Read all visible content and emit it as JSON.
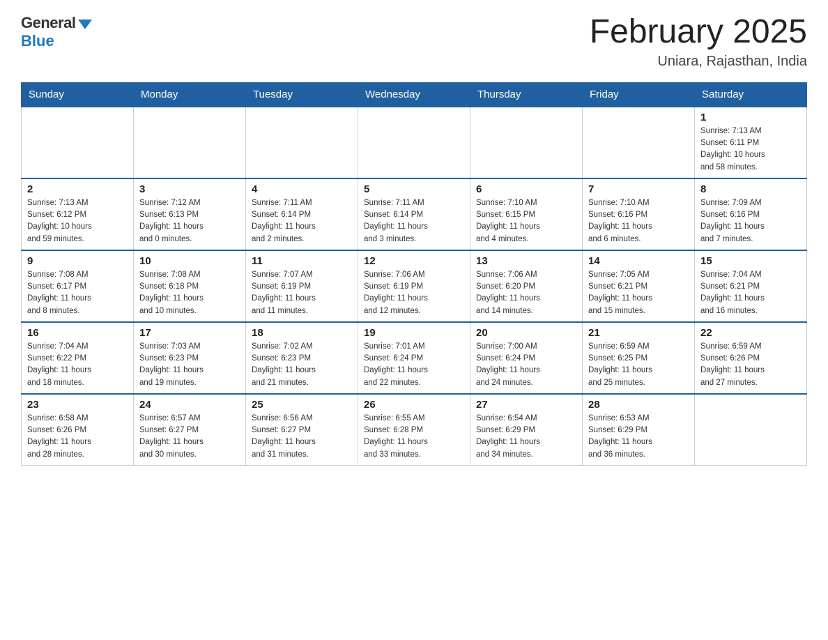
{
  "header": {
    "logo_general": "General",
    "logo_blue": "Blue",
    "month_title": "February 2025",
    "location": "Uniara, Rajasthan, India"
  },
  "days_of_week": [
    "Sunday",
    "Monday",
    "Tuesday",
    "Wednesday",
    "Thursday",
    "Friday",
    "Saturday"
  ],
  "weeks": [
    [
      {
        "day": "",
        "info": ""
      },
      {
        "day": "",
        "info": ""
      },
      {
        "day": "",
        "info": ""
      },
      {
        "day": "",
        "info": ""
      },
      {
        "day": "",
        "info": ""
      },
      {
        "day": "",
        "info": ""
      },
      {
        "day": "1",
        "info": "Sunrise: 7:13 AM\nSunset: 6:11 PM\nDaylight: 10 hours\nand 58 minutes."
      }
    ],
    [
      {
        "day": "2",
        "info": "Sunrise: 7:13 AM\nSunset: 6:12 PM\nDaylight: 10 hours\nand 59 minutes."
      },
      {
        "day": "3",
        "info": "Sunrise: 7:12 AM\nSunset: 6:13 PM\nDaylight: 11 hours\nand 0 minutes."
      },
      {
        "day": "4",
        "info": "Sunrise: 7:11 AM\nSunset: 6:14 PM\nDaylight: 11 hours\nand 2 minutes."
      },
      {
        "day": "5",
        "info": "Sunrise: 7:11 AM\nSunset: 6:14 PM\nDaylight: 11 hours\nand 3 minutes."
      },
      {
        "day": "6",
        "info": "Sunrise: 7:10 AM\nSunset: 6:15 PM\nDaylight: 11 hours\nand 4 minutes."
      },
      {
        "day": "7",
        "info": "Sunrise: 7:10 AM\nSunset: 6:16 PM\nDaylight: 11 hours\nand 6 minutes."
      },
      {
        "day": "8",
        "info": "Sunrise: 7:09 AM\nSunset: 6:16 PM\nDaylight: 11 hours\nand 7 minutes."
      }
    ],
    [
      {
        "day": "9",
        "info": "Sunrise: 7:08 AM\nSunset: 6:17 PM\nDaylight: 11 hours\nand 8 minutes."
      },
      {
        "day": "10",
        "info": "Sunrise: 7:08 AM\nSunset: 6:18 PM\nDaylight: 11 hours\nand 10 minutes."
      },
      {
        "day": "11",
        "info": "Sunrise: 7:07 AM\nSunset: 6:19 PM\nDaylight: 11 hours\nand 11 minutes."
      },
      {
        "day": "12",
        "info": "Sunrise: 7:06 AM\nSunset: 6:19 PM\nDaylight: 11 hours\nand 12 minutes."
      },
      {
        "day": "13",
        "info": "Sunrise: 7:06 AM\nSunset: 6:20 PM\nDaylight: 11 hours\nand 14 minutes."
      },
      {
        "day": "14",
        "info": "Sunrise: 7:05 AM\nSunset: 6:21 PM\nDaylight: 11 hours\nand 15 minutes."
      },
      {
        "day": "15",
        "info": "Sunrise: 7:04 AM\nSunset: 6:21 PM\nDaylight: 11 hours\nand 16 minutes."
      }
    ],
    [
      {
        "day": "16",
        "info": "Sunrise: 7:04 AM\nSunset: 6:22 PM\nDaylight: 11 hours\nand 18 minutes."
      },
      {
        "day": "17",
        "info": "Sunrise: 7:03 AM\nSunset: 6:23 PM\nDaylight: 11 hours\nand 19 minutes."
      },
      {
        "day": "18",
        "info": "Sunrise: 7:02 AM\nSunset: 6:23 PM\nDaylight: 11 hours\nand 21 minutes."
      },
      {
        "day": "19",
        "info": "Sunrise: 7:01 AM\nSunset: 6:24 PM\nDaylight: 11 hours\nand 22 minutes."
      },
      {
        "day": "20",
        "info": "Sunrise: 7:00 AM\nSunset: 6:24 PM\nDaylight: 11 hours\nand 24 minutes."
      },
      {
        "day": "21",
        "info": "Sunrise: 6:59 AM\nSunset: 6:25 PM\nDaylight: 11 hours\nand 25 minutes."
      },
      {
        "day": "22",
        "info": "Sunrise: 6:59 AM\nSunset: 6:26 PM\nDaylight: 11 hours\nand 27 minutes."
      }
    ],
    [
      {
        "day": "23",
        "info": "Sunrise: 6:58 AM\nSunset: 6:26 PM\nDaylight: 11 hours\nand 28 minutes."
      },
      {
        "day": "24",
        "info": "Sunrise: 6:57 AM\nSunset: 6:27 PM\nDaylight: 11 hours\nand 30 minutes."
      },
      {
        "day": "25",
        "info": "Sunrise: 6:56 AM\nSunset: 6:27 PM\nDaylight: 11 hours\nand 31 minutes."
      },
      {
        "day": "26",
        "info": "Sunrise: 6:55 AM\nSunset: 6:28 PM\nDaylight: 11 hours\nand 33 minutes."
      },
      {
        "day": "27",
        "info": "Sunrise: 6:54 AM\nSunset: 6:29 PM\nDaylight: 11 hours\nand 34 minutes."
      },
      {
        "day": "28",
        "info": "Sunrise: 6:53 AM\nSunset: 6:29 PM\nDaylight: 11 hours\nand 36 minutes."
      },
      {
        "day": "",
        "info": ""
      }
    ]
  ]
}
